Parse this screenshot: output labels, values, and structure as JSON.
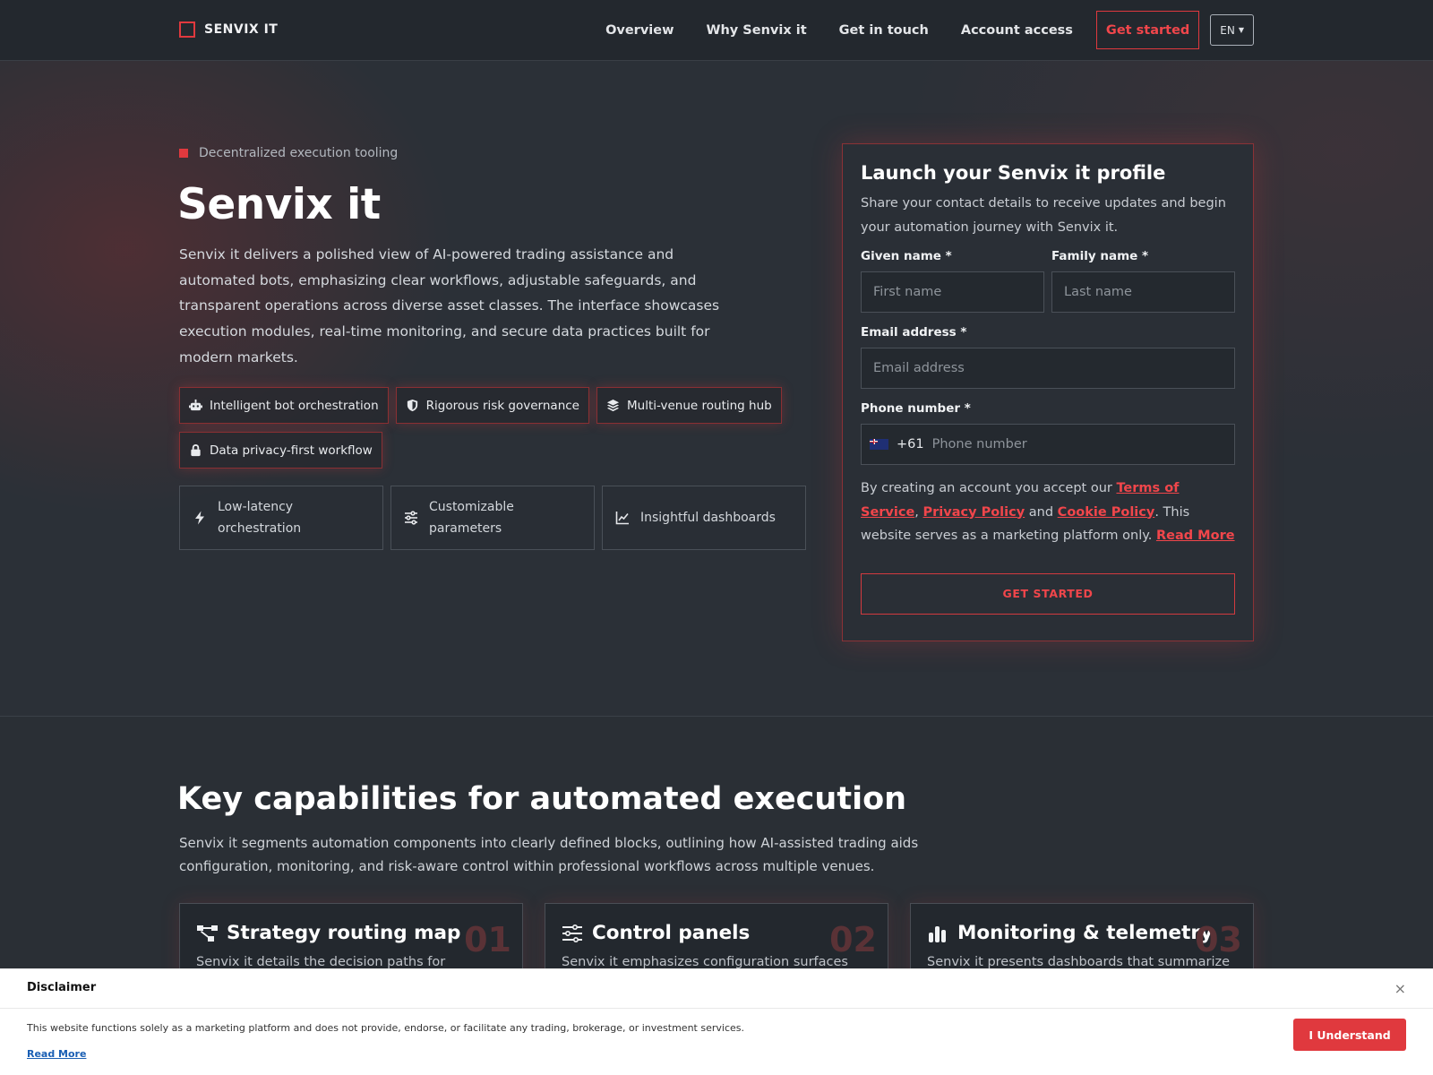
{
  "header": {
    "logo_text": "SENVIX IT",
    "nav": [
      "Overview",
      "Why Senvix it",
      "Get in touch",
      "Account access"
    ],
    "cta": "Get started",
    "lang": "EN"
  },
  "hero": {
    "eyebrow": "Decentralized execution tooling",
    "title": "Senvix it",
    "description": "Senvix it delivers a polished view of AI-powered trading assistance and automated bots, emphasizing clear workflows, adjustable safeguards, and transparent operations across diverse asset classes. The interface showcases execution modules, real-time monitoring, and secure data practices built for modern markets.",
    "pills": [
      {
        "label": "Intelligent bot orchestration",
        "icon": "robot-icon"
      },
      {
        "label": "Rigorous risk governance",
        "icon": "shield-icon"
      },
      {
        "label": "Multi-venue routing hub",
        "icon": "layers-icon"
      },
      {
        "label": "Data privacy-first workflow",
        "icon": "lock-icon"
      }
    ],
    "features": [
      {
        "label": "Low-latency orchestration",
        "icon": "bolt-icon"
      },
      {
        "label": "Customizable parameters",
        "icon": "sliders-icon"
      },
      {
        "label": "Insightful dashboards",
        "icon": "chart-line-icon"
      }
    ]
  },
  "form": {
    "title": "Launch your Senvix it profile",
    "subtitle": "Share your contact details to receive updates and begin your automation journey with Senvix it.",
    "given_label": "Given name *",
    "given_placeholder": "First name",
    "family_label": "Family name *",
    "family_placeholder": "Last name",
    "email_label": "Email address *",
    "email_placeholder": "Email address",
    "phone_label": "Phone number *",
    "phone_dial": "+61",
    "phone_placeholder": "Phone number",
    "legal_prefix": "By creating an account you accept our ",
    "terms": "Terms of Service",
    "sep1": ",",
    "privacy": "Privacy Policy",
    "and": " and ",
    "cookie": "Cookie Policy",
    "legal_suffix": ". This website serves as a marketing platform only. ",
    "read_more": "Read More",
    "submit": "GET STARTED"
  },
  "capabilities": {
    "title": "Key capabilities for automated execution",
    "description": "Senvix it segments automation components into clearly defined blocks, outlining how AI-assisted trading aids configuration, monitoring, and risk-aware control within professional workflows across multiple venues.",
    "cards": [
      {
        "title": "Strategy routing map",
        "num": "01",
        "icon": "routing-icon",
        "text": "Senvix it details the decision paths for"
      },
      {
        "title": "Control panels",
        "num": "02",
        "icon": "sliders-icon",
        "text": "Senvix it emphasizes configuration surfaces"
      },
      {
        "title": "Monitoring & telemetry",
        "num": "03",
        "icon": "bar-chart-icon",
        "text": "Senvix it presents dashboards that summarize"
      }
    ]
  },
  "disclaimer": {
    "title": "Disclaimer",
    "close": "×",
    "text": "This website functions solely as a marketing platform and does not provide, endorse, or facilitate any trading, brokerage, or investment services.",
    "link": "Read More",
    "button": "I Understand"
  },
  "colors": {
    "accent": "#e0393e",
    "bg": "#2a2f35",
    "header_bg": "#23282e"
  }
}
